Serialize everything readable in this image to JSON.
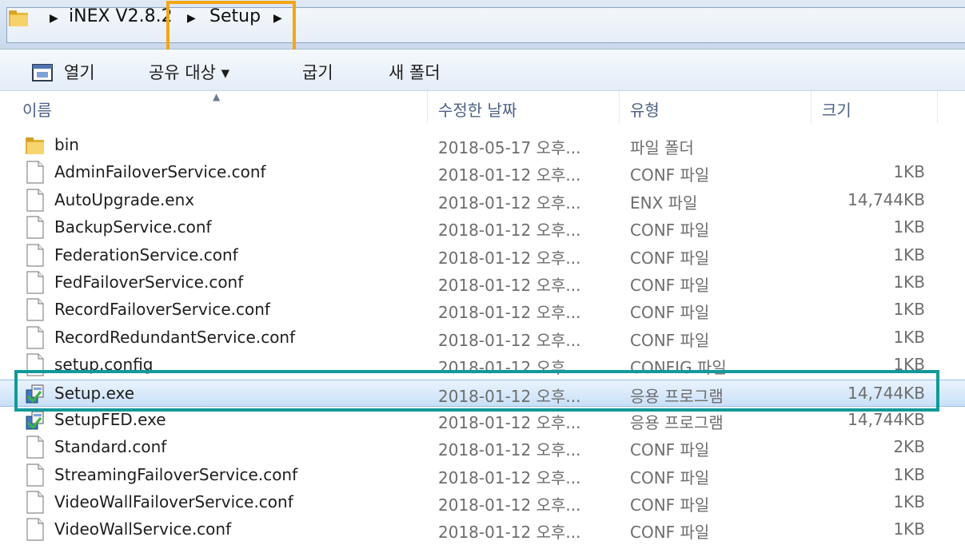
{
  "breadcrumb": {
    "items": [
      "iNEX V2.8.2",
      "Setup"
    ],
    "highlighted": "Setup"
  },
  "toolbar": {
    "open_label": "열기",
    "share_label": "공유 대상 ▾",
    "burn_label": "굽기",
    "new_folder_label": "새 폴더"
  },
  "columns": {
    "name": "이름",
    "date": "수정한 날짜",
    "type": "유형",
    "size": "크기"
  },
  "files": [
    {
      "name": "bin",
      "date": "2018-05-17 오후...",
      "type": "파일 폴더",
      "size": "",
      "icon": "folder-icon"
    },
    {
      "name": "AdminFailoverService.conf",
      "date": "2018-01-12 오후...",
      "type": "CONF 파일",
      "size": "1KB",
      "icon": "file-icon"
    },
    {
      "name": "AutoUpgrade.enx",
      "date": "2018-01-12 오후...",
      "type": "ENX 파일",
      "size": "14,744KB",
      "icon": "file-icon"
    },
    {
      "name": "BackupService.conf",
      "date": "2018-01-12 오후...",
      "type": "CONF 파일",
      "size": "1KB",
      "icon": "file-icon"
    },
    {
      "name": "FederationService.conf",
      "date": "2018-01-12 오후...",
      "type": "CONF 파일",
      "size": "1KB",
      "icon": "file-icon"
    },
    {
      "name": "FedFailoverService.conf",
      "date": "2018-01-12 오후...",
      "type": "CONF 파일",
      "size": "1KB",
      "icon": "file-icon"
    },
    {
      "name": "RecordFailoverService.conf",
      "date": "2018-01-12 오후...",
      "type": "CONF 파일",
      "size": "1KB",
      "icon": "file-icon"
    },
    {
      "name": "RecordRedundantService.conf",
      "date": "2018-01-12 오후...",
      "type": "CONF 파일",
      "size": "1KB",
      "icon": "file-icon"
    },
    {
      "name": "setup.config",
      "date": "2018-01-12 오후...",
      "type": "CONFIG 파일",
      "size": "1KB",
      "icon": "file-icon"
    },
    {
      "name": "Setup.exe",
      "date": "2018-01-12 오후...",
      "type": "응용 프로그램",
      "size": "14,744KB",
      "icon": "installer-icon",
      "selected": true
    },
    {
      "name": "SetupFED.exe",
      "date": "2018-01-12 오후...",
      "type": "응용 프로그램",
      "size": "14,744KB",
      "icon": "installer-icon"
    },
    {
      "name": "Standard.conf",
      "date": "2018-01-12 오후...",
      "type": "CONF 파일",
      "size": "2KB",
      "icon": "file-icon"
    },
    {
      "name": "StreamingFailoverService.conf",
      "date": "2018-01-12 오후...",
      "type": "CONF 파일",
      "size": "1KB",
      "icon": "file-icon"
    },
    {
      "name": "VideoWallFailoverService.conf",
      "date": "2018-01-12 오후...",
      "type": "CONF 파일",
      "size": "1KB",
      "icon": "file-icon"
    },
    {
      "name": "VideoWallService.conf",
      "date": "2018-01-12 오후...",
      "type": "CONF 파일",
      "size": "1KB",
      "icon": "file-icon"
    }
  ],
  "colors": {
    "breadcrumb_highlight": "#f3a616",
    "selection_highlight": "#12999b",
    "selected_row": "#c9e0f7"
  }
}
